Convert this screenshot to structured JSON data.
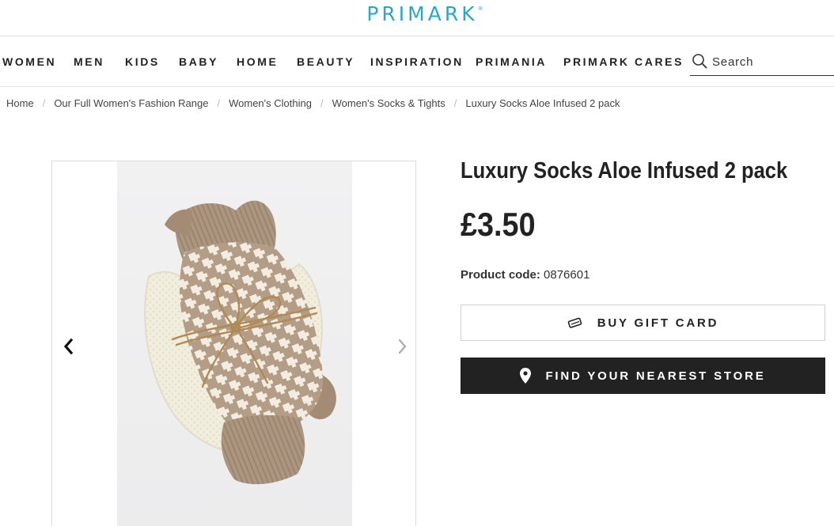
{
  "brand": {
    "logo_text": "PRIMARK",
    "logo_mark": "®",
    "logo_color": "#2aa6c9"
  },
  "nav": {
    "items": [
      {
        "label": "WOMEN"
      },
      {
        "label": "MEN"
      },
      {
        "label": "KIDS"
      },
      {
        "label": "BABY"
      },
      {
        "label": "HOME"
      },
      {
        "label": "BEAUTY"
      },
      {
        "label": "INSPIRATION"
      },
      {
        "label": "PRIMANIA"
      },
      {
        "label": "PRIMARK CARES"
      }
    ],
    "search": {
      "placeholder": "Search",
      "value": "",
      "icon": "search-icon"
    }
  },
  "breadcrumb": [
    {
      "label": "Home"
    },
    {
      "label": "Our Full Women's Fashion Range"
    },
    {
      "label": "Women's Clothing"
    },
    {
      "label": "Women's Socks & Tights"
    },
    {
      "label": "Luxury Socks Aloe Infused 2 pack"
    }
  ],
  "gallery": {
    "image_alt": "Luxury Socks Aloe Infused 2 pack",
    "prev_icon": "chevron-left-icon",
    "next_icon": "chevron-right-icon"
  },
  "product": {
    "title": "Luxury Socks Aloe Infused 2 pack",
    "price": "£3.50",
    "code_label": "Product code:",
    "code": "0876601"
  },
  "actions": {
    "gift_card_label": "BUY GIFT CARD",
    "gift_card_icon": "gift-card-icon",
    "store_label": "FIND YOUR NEAREST STORE",
    "store_icon": "location-pin-icon",
    "store_button_color": "#222222"
  }
}
